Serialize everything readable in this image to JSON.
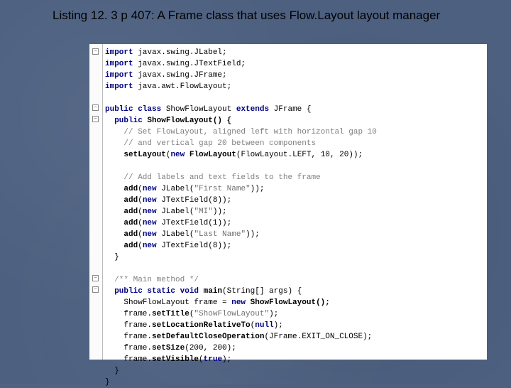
{
  "title": "Listing 12. 3 p 407:  A Frame class that uses Flow.Layout layout manager",
  "code": {
    "l1": "import",
    "l1b": " javax.swing.JLabel;",
    "l2": "import",
    "l2b": " javax.swing.JTextField;",
    "l3": "import",
    "l3b": " javax.swing.JFrame;",
    "l4": "import",
    "l4b": " java.awt.FlowLayout;",
    "l6a": "public class",
    "l6b": " ShowFlowLayout ",
    "l6c": "extends",
    "l6d": " JFrame {",
    "l7a": "  public",
    "l7b": " ShowFlowLayout() {",
    "l8": "    // Set FlowLayout, aligned left with horizontal gap 10",
    "l9": "    // and vertical gap 20 between components",
    "l10a": "    setLayout",
    "l10b": "(",
    "l10c": "new",
    "l10d": " FlowLayout",
    "l10e": "(FlowLayout.LEFT, 10, 20));",
    "l12": "    // Add labels and text fields to the frame",
    "l13a": "    add",
    "l13b": "(",
    "l13c": "new",
    "l13d": " JLabel(",
    "l13e": "\"First Name\"",
    "l13f": "));",
    "l14a": "    add",
    "l14b": "(",
    "l14c": "new",
    "l14d": " JTextField(8));",
    "l15a": "    add",
    "l15b": "(",
    "l15c": "new",
    "l15d": " JLabel(",
    "l15e": "\"MI\"",
    "l15f": "));",
    "l16a": "    add",
    "l16b": "(",
    "l16c": "new",
    "l16d": " JTextField(1));",
    "l17a": "    add",
    "l17b": "(",
    "l17c": "new",
    "l17d": " JLabel(",
    "l17e": "\"Last Name\"",
    "l17f": "));",
    "l18a": "    add",
    "l18b": "(",
    "l18c": "new",
    "l18d": " JTextField(8));",
    "l19": "  }",
    "l21": "  /** Main method */",
    "l22a": "  public static void",
    "l22b": " main",
    "l22c": "(String[] args) {",
    "l23a": "    ShowFlowLayout frame = ",
    "l23b": "new",
    "l23c": " ShowFlowLayout();",
    "l24a": "    frame.",
    "l24b": "setTitle",
    "l24c": "(",
    "l24d": "\"ShowFlowLayout\"",
    "l24e": ");",
    "l25a": "    frame.",
    "l25b": "setLocationRelativeTo",
    "l25c": "(",
    "l25d": "null",
    "l25e": ");",
    "l26a": "    frame.",
    "l26b": "setDefaultCloseOperation",
    "l26c": "(JFrame.EXIT_ON_CLOSE);",
    "l27a": "    frame.",
    "l27b": "setSize",
    "l27c": "(200, 200);",
    "l28a": "    frame.",
    "l28b": "setVisible",
    "l28c": "(",
    "l28d": "true",
    "l28e": ");",
    "l29": "  }",
    "l30": "}"
  },
  "fold_glyph": "−"
}
